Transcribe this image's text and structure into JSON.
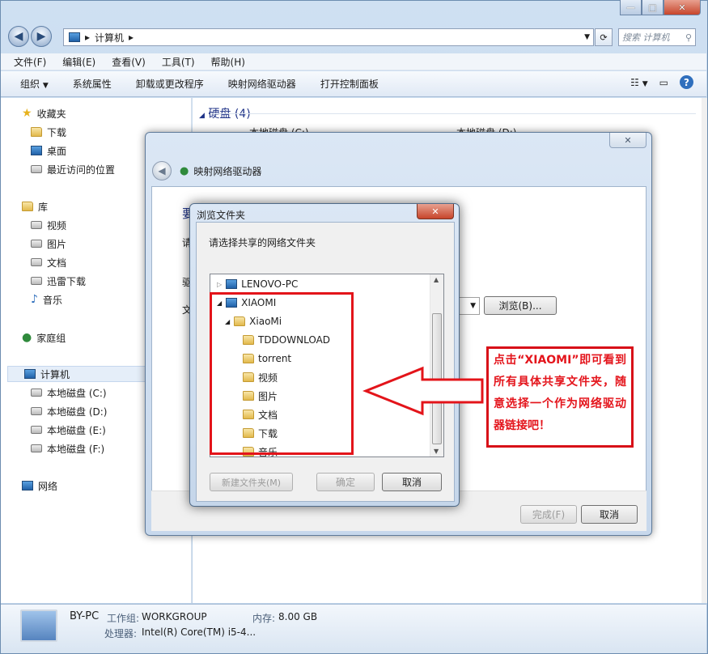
{
  "address": {
    "path": "计算机",
    "search_placeholder": "搜索 计算机"
  },
  "menu": [
    "文件(F)",
    "编辑(E)",
    "查看(V)",
    "工具(T)",
    "帮助(H)"
  ],
  "toolbar": {
    "organize": "组织",
    "items": [
      "系统属性",
      "卸载或更改程序",
      "映射网络驱动器",
      "打开控制面板"
    ]
  },
  "nav": {
    "favorites": "收藏夹",
    "fav_items": [
      "下载",
      "桌面",
      "最近访问的位置"
    ],
    "library": "库",
    "lib_items": [
      "视频",
      "图片",
      "文档",
      "迅雷下载",
      "音乐"
    ],
    "homegroup": "家庭组",
    "computer": "计算机",
    "drives": [
      "本地磁盘 (C:)",
      "本地磁盘 (D:)",
      "本地磁盘 (E:)",
      "本地磁盘 (F:)"
    ],
    "network": "网络"
  },
  "content": {
    "group": "硬盘 (4)",
    "drive_c": "本地磁盘 (C:)",
    "drive_d": "本地磁盘 (D:)"
  },
  "details": {
    "name": "BY-PC",
    "workgroup_label": "工作组:",
    "workgroup": "WORKGROUP",
    "memory_label": "内存:",
    "memory": "8.00 GB",
    "cpu_label": "处理器:",
    "cpu": "Intel(R) Core(TM) i5-4..."
  },
  "map_dialog": {
    "title": "映射网络驱动器",
    "partial": [
      "要",
      "请",
      "驱",
      "文"
    ],
    "browse": "浏览(B)...",
    "finish": "完成(F)",
    "cancel": "取消"
  },
  "browse_dialog": {
    "title": "浏览文件夹",
    "prompt": "请选择共享的网络文件夹",
    "tree": [
      "LENOVO-PC",
      "XIAOMI",
      "XiaoMi",
      "TDDOWNLOAD",
      "torrent",
      "视频",
      "图片",
      "文档",
      "下载",
      "音乐"
    ],
    "new_folder": "新建文件夹(M)",
    "ok": "确定",
    "cancel": "取消"
  },
  "annotation": "点击“XIAOMI”即可看到所有具体共享文件夹，随意选择一个作为网络驱动器链接吧！",
  "colors": {
    "accent_red": "#e3141a",
    "window_frame": "#b9cfe6"
  }
}
